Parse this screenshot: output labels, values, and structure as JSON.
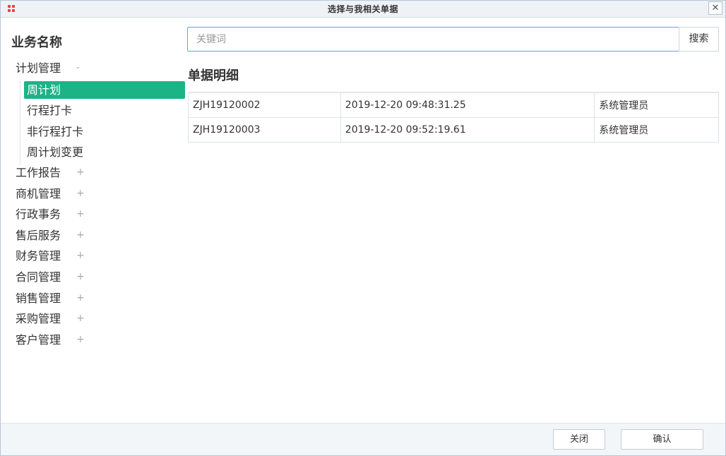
{
  "window": {
    "title": "选择与我相关单据",
    "close_glyph": "✕"
  },
  "sidebar": {
    "title": "业务名称",
    "groups": [
      {
        "label": "计划管理",
        "toggle": "-",
        "expanded": true,
        "children": [
          "周计划",
          "行程打卡",
          "非行程打卡",
          "周计划变更"
        ],
        "active_child": "周计划"
      },
      {
        "label": "工作报告",
        "toggle": "+"
      },
      {
        "label": "商机管理",
        "toggle": "+"
      },
      {
        "label": "行政事务",
        "toggle": "+"
      },
      {
        "label": "售后服务",
        "toggle": "+"
      },
      {
        "label": "财务管理",
        "toggle": "+"
      },
      {
        "label": "合同管理",
        "toggle": "+"
      },
      {
        "label": "销售管理",
        "toggle": "+"
      },
      {
        "label": "采购管理",
        "toggle": "+"
      },
      {
        "label": "客户管理",
        "toggle": "+"
      }
    ]
  },
  "search": {
    "placeholder": "关键词",
    "value": "",
    "button_label": "搜索"
  },
  "detail": {
    "title": "单据明细",
    "rows": [
      [
        "ZJH19120002",
        "2019-12-20 09:48:31.25",
        "系统管理员"
      ],
      [
        "ZJH19120003",
        "2019-12-20 09:52:19.61",
        "系统管理员"
      ]
    ]
  },
  "footer": {
    "close_label": "关闭",
    "confirm_label": "确认"
  },
  "colors": {
    "accent": "#1cb387",
    "app_icon": "#e04545",
    "input_border": "#4ab3c9"
  },
  "icons": {
    "app": "app-grid-icon",
    "close": "close-icon"
  }
}
